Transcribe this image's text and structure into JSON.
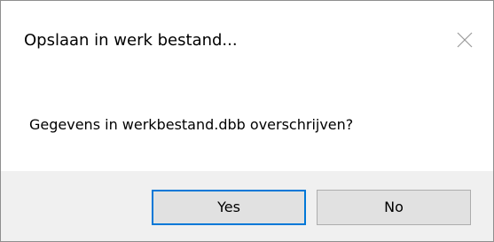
{
  "dialog": {
    "title": "Opslaan in werk bestand...",
    "message": "Gegevens in werkbestand.dbb overschrijven?",
    "close_icon": "close-icon",
    "buttons": {
      "yes_label": "Yes",
      "no_label": "No"
    },
    "colors": {
      "footer_background": "#f0f0f0",
      "default_button_border": "#0078d7",
      "button_background": "#e1e1e1"
    }
  }
}
